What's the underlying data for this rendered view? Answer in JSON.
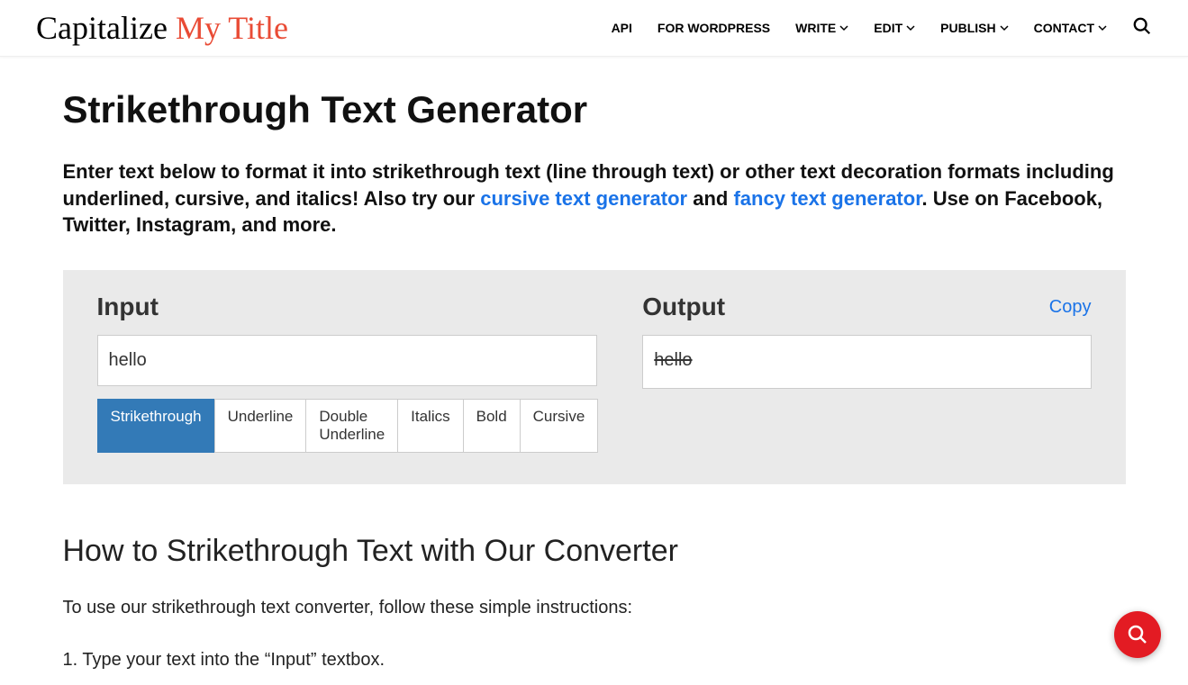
{
  "header": {
    "logo_part1": "Capitalize ",
    "logo_part2": "My Title",
    "nav": [
      {
        "label": "API",
        "has_dropdown": false
      },
      {
        "label": "FOR WORDPRESS",
        "has_dropdown": false
      },
      {
        "label": "WRITE",
        "has_dropdown": true
      },
      {
        "label": "EDIT",
        "has_dropdown": true
      },
      {
        "label": "PUBLISH",
        "has_dropdown": true
      },
      {
        "label": "CONTACT",
        "has_dropdown": true
      }
    ]
  },
  "page": {
    "title": "Strikethrough Text Generator",
    "intro_part1": "Enter text below to format it into strikethrough text (line through text) or other text decoration formats including underlined, cursive, and italics! Also try our ",
    "intro_link1": "cursive text generator",
    "intro_mid": " and ",
    "intro_link2": "fancy text generator",
    "intro_part2": ". Use on Facebook, Twitter, Instagram, and more."
  },
  "tool": {
    "input_label": "Input",
    "output_label": "Output",
    "copy_label": "Copy",
    "input_value": "hello",
    "output_value": "hello ",
    "tabs": [
      "Strikethrough",
      "Underline",
      "Double Underline",
      "Italics",
      "Bold",
      "Cursive"
    ],
    "active_tab": "Strikethrough"
  },
  "howto": {
    "title": "How to Strikethrough Text with Our Converter",
    "intro": "To use our strikethrough text converter, follow these simple instructions:",
    "step1": "1. Type your text into the “Input” textbox."
  }
}
